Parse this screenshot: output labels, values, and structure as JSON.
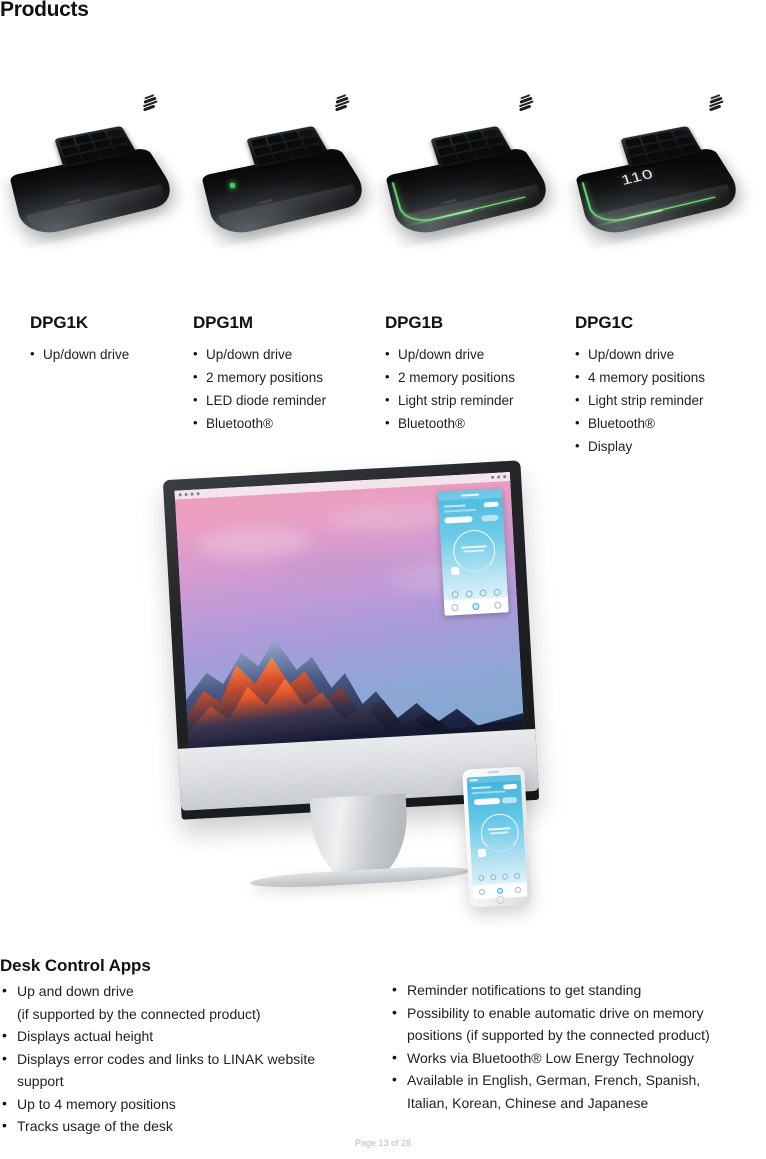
{
  "page": {
    "title": "Products",
    "footer": "Page 13 of 28"
  },
  "products": [
    {
      "name": "DPG1K",
      "features": [
        "Up/down drive"
      ],
      "visual": {
        "has_led": false,
        "has_light_strip": false,
        "has_display": false,
        "display_value": "",
        "logo": "LINAK"
      }
    },
    {
      "name": "DPG1M",
      "features": [
        "Up/down drive",
        "2 memory positions",
        "LED diode reminder",
        "Bluetooth®"
      ],
      "visual": {
        "has_led": true,
        "has_light_strip": false,
        "has_display": false,
        "display_value": "",
        "logo": "LINAK"
      }
    },
    {
      "name": "DPG1B",
      "features": [
        "Up/down drive",
        "2 memory positions",
        "Light strip reminder",
        "Bluetooth®"
      ],
      "visual": {
        "has_led": false,
        "has_light_strip": true,
        "has_display": false,
        "display_value": "",
        "logo": "LINAK"
      }
    },
    {
      "name": "DPG1C",
      "features": [
        "Up/down drive",
        "4 memory positions",
        "Light strip reminder",
        "Bluetooth®",
        "Display"
      ],
      "visual": {
        "has_led": false,
        "has_light_strip": true,
        "has_display": true,
        "display_value": "110",
        "logo": "LINAK"
      }
    }
  ],
  "desk_control_apps": {
    "title": "Desk Control Apps",
    "left_column": [
      {
        "text": "Up and down drive",
        "continuation": "(if supported by the connected product)"
      },
      {
        "text": "Displays actual height",
        "continuation": ""
      },
      {
        "text": "Displays error codes and links to LINAK website",
        "continuation": "support"
      },
      {
        "text": "Up to 4 memory positions",
        "continuation": ""
      },
      {
        "text": "Tracks usage of the desk",
        "continuation": ""
      }
    ],
    "right_column": [
      {
        "text": "Reminder notifications to get standing",
        "continuation": ""
      },
      {
        "text": "Possibility to enable automatic drive on memory",
        "continuation": "positions (if supported by the connected product)"
      },
      {
        "text": "Works via Bluetooth® Low Energy Technology",
        "continuation": ""
      },
      {
        "text": "Available in English, German, French, Spanish,",
        "continuation": "Italian, Korean, Chinese and Japanese"
      }
    ]
  },
  "colors": {
    "light_strip_green": "#6fdc7a",
    "led_green": "#49c95c",
    "app_accent_cyan": "#3fb4dd",
    "footer_gray": "#b2bcc0"
  }
}
